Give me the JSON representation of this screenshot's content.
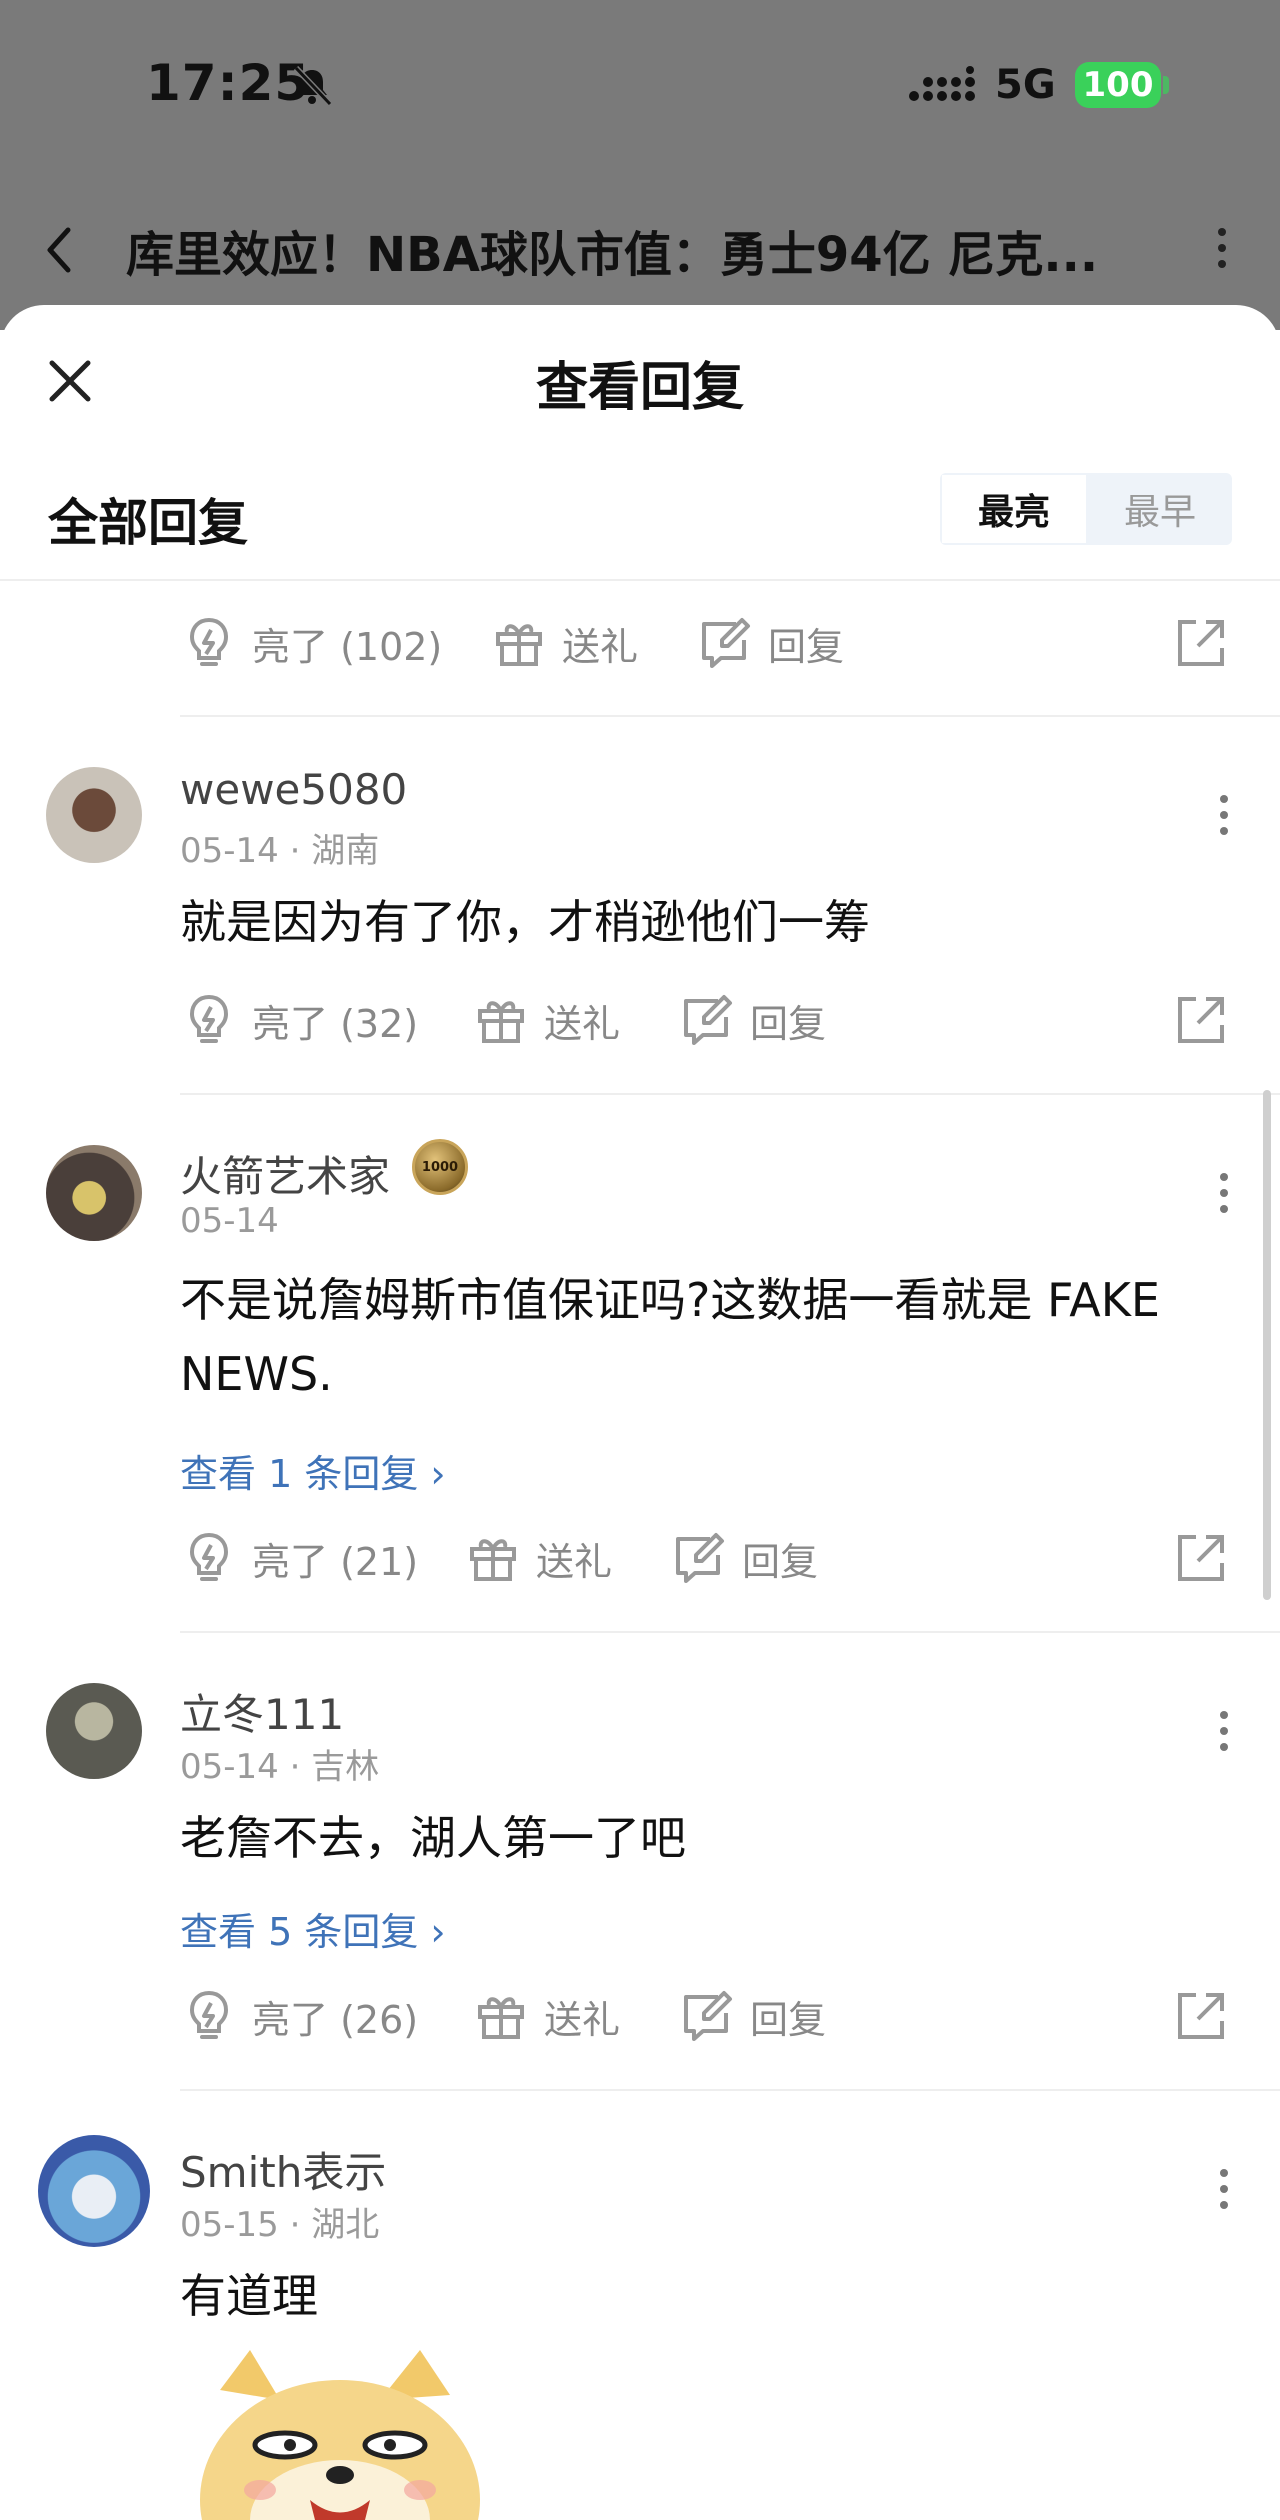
{
  "status_bar": {
    "time": "17:25",
    "network": "5G",
    "battery": "100"
  },
  "article": {
    "title": "库里效应！NBA球队市值：勇士94亿 尼克..."
  },
  "sheet": {
    "title": "查看回复",
    "section_title": "全部回复",
    "sort_options": [
      "最亮",
      "最早"
    ],
    "active_sort": "最亮"
  },
  "top_actions": {
    "light": "亮了 (102)",
    "gift": "送礼",
    "reply": "回复"
  },
  "comments": [
    {
      "username": "wewe5080",
      "meta": "05-14 · 湖南",
      "text": "就是因为有了你，才稍逊他们一筹",
      "light": "亮了 (32)",
      "gift": "送礼",
      "reply": "回复"
    },
    {
      "username": "火箭艺术家",
      "meta": "05-14",
      "text": "不是说詹姆斯市值保证吗?这数据一看就是 FAKE NEWS.",
      "view_replies": "查看 1 条回复 ›",
      "light": "亮了 (21)",
      "gift": "送礼",
      "reply": "回复"
    },
    {
      "username": "立冬111",
      "meta": "05-14 · 吉林",
      "text": "老詹不去，湖人第一了吧",
      "view_replies": "查看 5 条回复 ›",
      "light": "亮了 (26)",
      "gift": "送礼",
      "reply": "回复"
    },
    {
      "username": "Smith表示",
      "meta": "05-15 · 湖北",
      "text": "有道理"
    }
  ],
  "colors": {
    "link": "#3f73b8",
    "battery": "#3ad15a",
    "backdrop": "#7a7a7a"
  }
}
